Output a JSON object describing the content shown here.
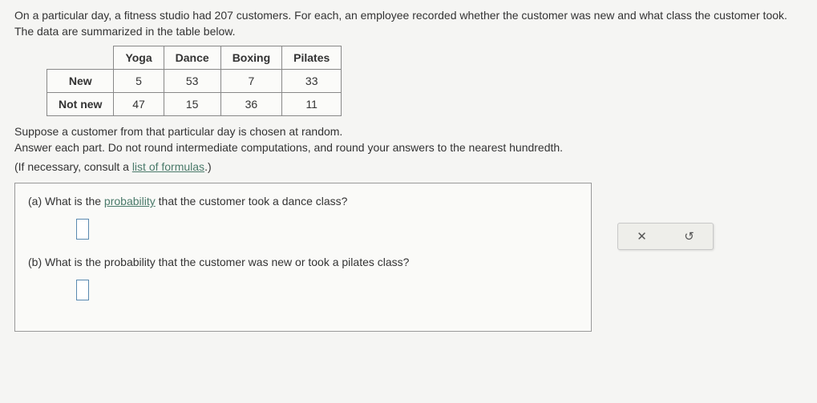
{
  "intro": {
    "part1": "On a particular day, a fitness studio had ",
    "count": "207",
    "part2": " customers. For each, an employee recorded whether the customer was new and what class the customer took. The data are summarized in the table below."
  },
  "table": {
    "cols": [
      "Yoga",
      "Dance",
      "Boxing",
      "Pilates"
    ],
    "rows": [
      {
        "label": "New",
        "vals": [
          "5",
          "53",
          "7",
          "33"
        ]
      },
      {
        "label": "Not new",
        "vals": [
          "47",
          "15",
          "36",
          "11"
        ]
      }
    ]
  },
  "suppose": {
    "line1": "Suppose a customer from that particular day is chosen at random.",
    "line2": "Answer each part. Do not round intermediate computations, and round your answers to the nearest hundredth."
  },
  "formulas": {
    "prefix": "(If necessary, consult a ",
    "link": "list of formulas",
    "suffix": ".)"
  },
  "qa": {
    "a": {
      "prefix": "(a) What is the ",
      "link": "probability",
      "suffix": " that the customer took a dance class?"
    },
    "b": {
      "text": "(b) What is the probability that the customer was new or took a pilates class?"
    }
  },
  "controls": {
    "close": "✕",
    "reset": "↺"
  }
}
